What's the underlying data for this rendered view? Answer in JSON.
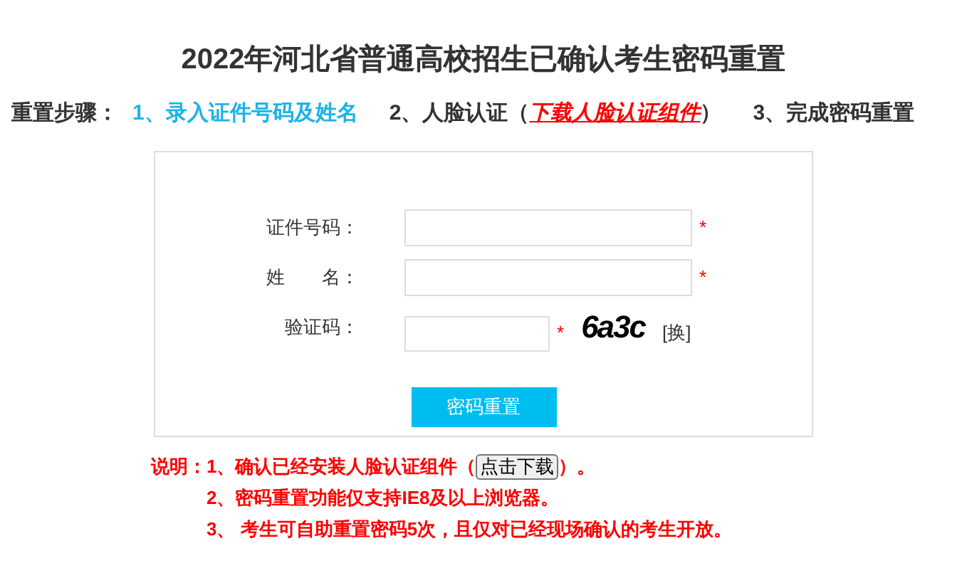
{
  "title": "2022年河北省普通高校招生已确认考生密码重置",
  "steps_label": "重置步骤：",
  "steps": [
    {
      "text": "1、录入证件号码及姓名",
      "selected": true
    },
    {
      "text": "2、人脸认证（",
      "link": "下载人脸认证组件",
      "after": "）",
      "selected": false
    },
    {
      "text": "3、完成密码重置",
      "selected": false
    }
  ],
  "form": {
    "fields": [
      {
        "label": "证件号码：",
        "kind": "text",
        "required": "*"
      },
      {
        "label": "姓　　名：",
        "kind": "text",
        "required": "*"
      },
      {
        "label": "验证码：",
        "kind": "captcha",
        "required": "*",
        "captcha": "6a3c",
        "refresh": "[换]"
      }
    ],
    "submit": "密码重置"
  },
  "notes": {
    "label": "说明：",
    "items": [
      {
        "before": "1、确认已经安装人脸认证组件（",
        "button": "点击下载",
        "after": "）。"
      },
      {
        "before": "2、密码重置功能仅支持IE8及以上浏览器。"
      },
      {
        "before": "3、 考生可自助重置密码5次，且仅对已经现场确认的考生开放。"
      }
    ]
  }
}
